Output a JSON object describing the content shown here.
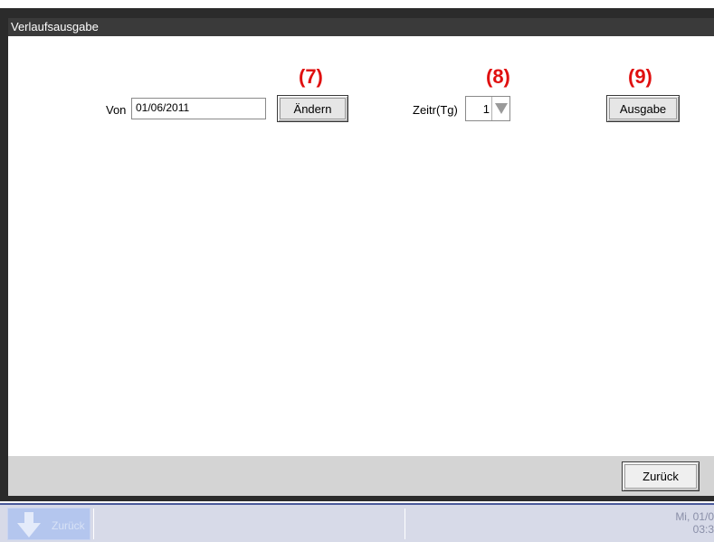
{
  "window": {
    "title": "Verlaufsausgabe"
  },
  "annotations": {
    "a7": "(7)",
    "a8": "(8)",
    "a9": "(9)"
  },
  "from": {
    "label": "Von",
    "value": "01/06/2011",
    "change_button": "Ändern"
  },
  "period": {
    "label": "Zeitr(Tg)",
    "value": "1"
  },
  "output_button": "Ausgabe",
  "footer": {
    "back_button": "Zurück"
  },
  "taskbar": {
    "back_label": "Zurück",
    "date_line1": "Mi, 01/0",
    "date_line2": "03:3"
  },
  "colors": {
    "annotation": "#e01010",
    "taskbar_accent": "#4a5a9a"
  }
}
